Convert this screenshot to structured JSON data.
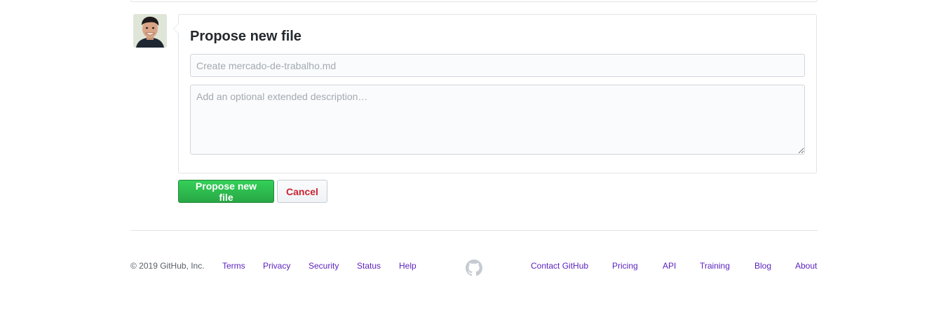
{
  "form": {
    "title": "Propose new file",
    "summary_placeholder": "Create mercado-de-trabalho.md",
    "summary_value": "",
    "description_placeholder": "Add an optional extended description…",
    "description_value": "",
    "submit_label": "Propose new file",
    "cancel_label": "Cancel"
  },
  "footer": {
    "copyright": "© 2019 GitHub, Inc.",
    "left_links": [
      "Terms",
      "Privacy",
      "Security",
      "Status",
      "Help"
    ],
    "right_links": [
      "Contact GitHub",
      "Pricing",
      "API",
      "Training",
      "Blog",
      "About"
    ],
    "logo_icon": "github-mark-icon"
  },
  "colors": {
    "primary_button": "#28a745",
    "danger_text": "#cb2431",
    "link": "#5a1fbe",
    "border": "#e1e4e8"
  }
}
